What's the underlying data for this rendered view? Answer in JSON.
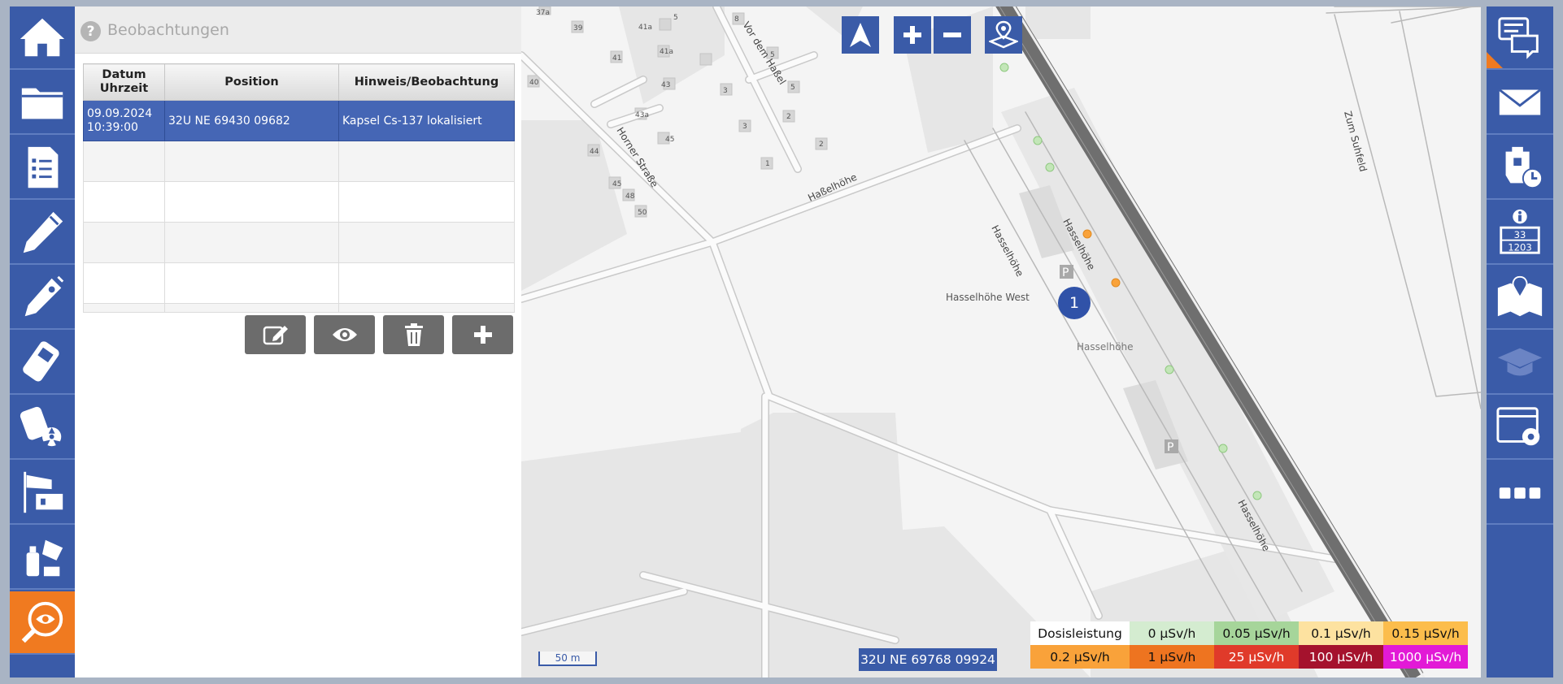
{
  "left_nav": {
    "items": [
      {
        "name": "home-icon"
      },
      {
        "name": "folder-icon"
      },
      {
        "name": "checklist-icon"
      },
      {
        "name": "pen-icon"
      },
      {
        "name": "dosimeter-probe-icon"
      },
      {
        "name": "handheld-meter-icon"
      },
      {
        "name": "radiation-meter-icon"
      },
      {
        "name": "windsock-icon"
      },
      {
        "name": "chemical-bottles-icon"
      },
      {
        "name": "observation-search-icon",
        "active": true
      }
    ],
    "active_color": "#f07a20",
    "color": "#3a5ba8"
  },
  "panel": {
    "title": "Beobachtungen",
    "help_icon": "?",
    "table": {
      "headers": [
        "Datum\nUhrzeit",
        "Position",
        "Hinweis/Beobachtung"
      ],
      "rows": [
        {
          "date": "09.09.2024\n10:39:00",
          "position": "32U NE 69430 09682",
          "note": "Kapsel Cs-137 lokalisiert",
          "selected": true
        }
      ]
    },
    "actions": [
      {
        "name": "edit-button",
        "icon": "edit-icon"
      },
      {
        "name": "view-button",
        "icon": "eye-icon"
      },
      {
        "name": "delete-button",
        "icon": "trash-icon"
      },
      {
        "name": "add-button",
        "icon": "plus-icon"
      }
    ]
  },
  "map": {
    "controls": [
      "north-arrow-icon",
      "zoom-in-icon",
      "zoom-out-icon",
      "location-icon"
    ],
    "labels": {
      "vor_dem_hassel": "Vor dem Haßel",
      "horner_strasse": "Horner Straße",
      "hasselhoehe_road": "Haßelhöhe",
      "hasselhoehe_a": "Hasselhöhe",
      "hasselhoehe_b": "Hasselhöhe",
      "hasselhoehe_c": "Hasselhöhe",
      "hasselhoehe_d": "Hasselhöhe",
      "hasselhoehe_west": "Hasselhöhe West",
      "zum_suhfeld": "Zum Suhfeld"
    },
    "house_numbers": [
      "37a",
      "39",
      "41a",
      "41",
      "5",
      "8",
      "41a",
      "43",
      "43a",
      "45",
      "44",
      "45",
      "48",
      "50",
      "5",
      "3",
      "3",
      "2",
      "1",
      "40",
      "1",
      "6"
    ],
    "marker_label": "1",
    "scale_label": "50 m",
    "coordinate": "32U NE 69768 09924",
    "legend": {
      "title": "Dosisleistung",
      "entries": [
        {
          "label": "0 µSv/h",
          "color": "#d4ecd0"
        },
        {
          "label": "0.05 µSv/h",
          "color": "#a6d59a"
        },
        {
          "label": "0.1 µSv/h",
          "color": "#fde2a0"
        },
        {
          "label": "0.15 µSv/h",
          "color": "#fcbd4c"
        },
        {
          "label": "0.2 µSv/h",
          "color": "#f9a23a"
        },
        {
          "label": "1 µSv/h",
          "color": "#ee7420"
        },
        {
          "label": "25 µSv/h",
          "color": "#e03a2a"
        },
        {
          "label": "100 µSv/h",
          "color": "#a5122d"
        },
        {
          "label": "1000 µSv/h",
          "color": "#e21ad6"
        }
      ]
    }
  },
  "right_nav": {
    "items": [
      {
        "name": "chat-icon"
      },
      {
        "name": "mail-icon"
      },
      {
        "name": "breathing-mask-timer-icon"
      },
      {
        "name": "info-numbers-icon",
        "text_top": "33",
        "text_bottom": "1203"
      },
      {
        "name": "map-location-icon"
      },
      {
        "name": "graduation-cap-icon"
      },
      {
        "name": "window-settings-icon"
      },
      {
        "name": "more-icon"
      }
    ]
  }
}
